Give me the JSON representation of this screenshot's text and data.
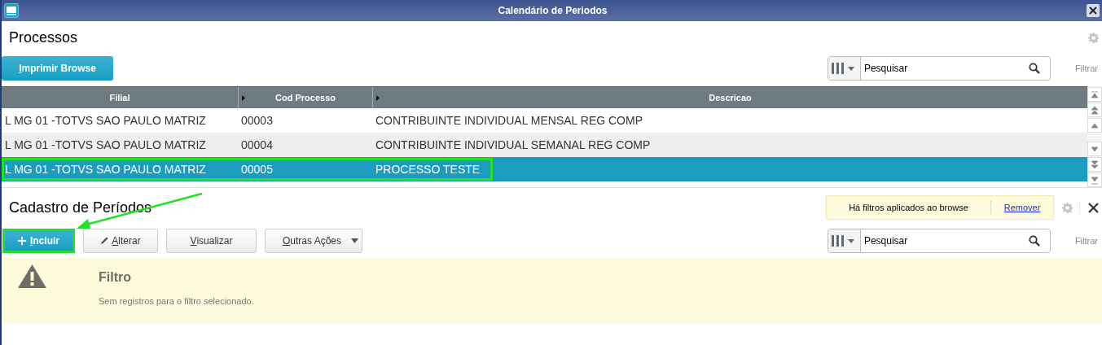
{
  "window": {
    "title": "Calendário de Periodos"
  },
  "processos": {
    "title": "Processos",
    "print_button": "Imprimir Browse",
    "search": {
      "placeholder": "Pesquisar"
    },
    "filter_link": "Filtrar",
    "columns": [
      "Filial",
      "Cod Processo",
      "Descricao"
    ],
    "rows": [
      {
        "cells": [
          "L MG 01 -TOTVS SAO PAULO MATRIZ",
          "00003",
          "CONTRIBUINTE INDIVIDUAL MENSAL REG COMP"
        ],
        "selected": false
      },
      {
        "cells": [
          "L MG 01 -TOTVS SAO PAULO MATRIZ",
          "00004",
          "CONTRIBUINTE INDIVIDUAL SEMANAL REG COMP"
        ],
        "selected": false
      },
      {
        "cells": [
          "L MG 01 -TOTVS SAO PAULO MATRIZ",
          "00005",
          "PROCESSO TESTE"
        ],
        "selected": true
      }
    ]
  },
  "cadastro": {
    "title": "Cadastro de Períodos",
    "filter_notice": "Há filtros aplicados ao browse",
    "remove_link": "Remover",
    "buttons": [
      {
        "label": "Incluir",
        "kind": "primary"
      },
      {
        "label": "Alterar",
        "kind": "edit"
      },
      {
        "label": "Visualizar",
        "kind": "plain"
      },
      {
        "label": "Outras Ações",
        "kind": "menu"
      }
    ],
    "search": {
      "placeholder": "Pesquisar"
    },
    "filter_link": "Filtrar",
    "message": {
      "title": "Filtro",
      "text": "Sem registros para o filtro selecionado."
    }
  }
}
